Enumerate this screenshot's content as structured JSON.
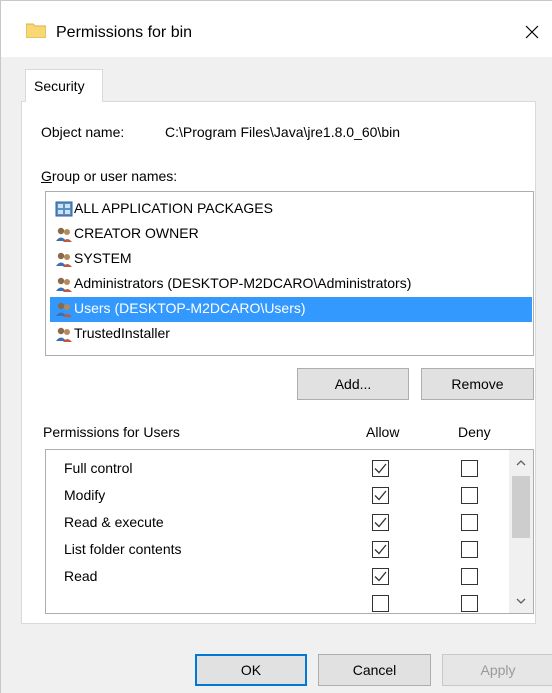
{
  "window": {
    "title": "Permissions for bin",
    "icon": "folder-icon",
    "close_icon": "close-icon"
  },
  "tabs": [
    {
      "label": "Security",
      "active": true
    }
  ],
  "object": {
    "label": "Object name:",
    "value": "C:\\Program Files\\Java\\jre1.8.0_60\\bin"
  },
  "groups": {
    "label": "Group or user names:",
    "items": [
      {
        "label": "ALL APPLICATION PACKAGES",
        "icon": "packages-icon",
        "selected": false
      },
      {
        "label": "CREATOR OWNER",
        "icon": "users-icon",
        "selected": false
      },
      {
        "label": "SYSTEM",
        "icon": "users-icon",
        "selected": false
      },
      {
        "label": "Administrators (DESKTOP-M2DCARO\\Administrators)",
        "icon": "users-icon",
        "selected": false
      },
      {
        "label": "Users (DESKTOP-M2DCARO\\Users)",
        "icon": "users-icon",
        "selected": true
      },
      {
        "label": "TrustedInstaller",
        "icon": "users-icon",
        "selected": false
      }
    ]
  },
  "group_buttons": {
    "add": "Add...",
    "remove": "Remove"
  },
  "permissions": {
    "label": "Permissions for Users",
    "allow_header": "Allow",
    "deny_header": "Deny",
    "items": [
      {
        "label": "Full control",
        "allow": true,
        "deny": false
      },
      {
        "label": "Modify",
        "allow": true,
        "deny": false
      },
      {
        "label": "Read & execute",
        "allow": true,
        "deny": false
      },
      {
        "label": "List folder contents",
        "allow": true,
        "deny": false
      },
      {
        "label": "Read",
        "allow": true,
        "deny": false
      }
    ]
  },
  "footer": {
    "ok": "OK",
    "cancel": "Cancel",
    "apply": "Apply"
  },
  "colors": {
    "selection": "#3399ff",
    "default_button_border": "#0078d7",
    "folder": "#f8d775"
  }
}
